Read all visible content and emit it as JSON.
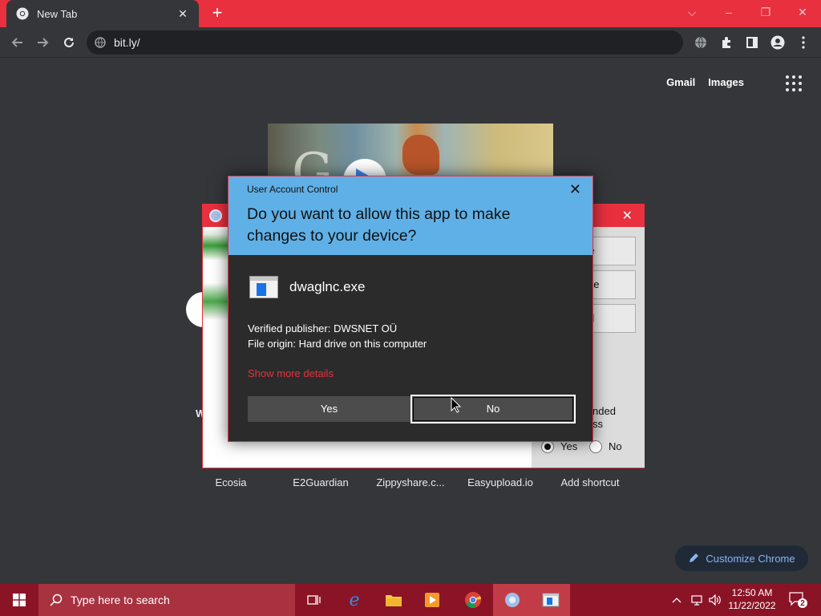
{
  "browser": {
    "tab": {
      "title": "New Tab"
    },
    "address": {
      "url": "bit.ly/"
    },
    "new_tab_label": "+",
    "window_controls": {
      "minimize": "–",
      "restore": "❐",
      "close": "✕",
      "tabsearch": "⌵"
    }
  },
  "newtab_page": {
    "top_links": [
      "Gmail",
      "Images"
    ],
    "shortcuts": [
      {
        "label": "Ecosia"
      },
      {
        "label": "E2Guardian"
      },
      {
        "label": "Zippyshare.c..."
      },
      {
        "label": "Easyupload.io"
      },
      {
        "label": "Add shortcut"
      }
    ],
    "customize_label": "Customize Chrome",
    "doodle_text": "G"
  },
  "installer": {
    "buttons": [
      "ble",
      "igure",
      "tall"
    ],
    "option_text": [
      "nded",
      "ss"
    ],
    "radio_yes": "Yes",
    "radio_no": "No",
    "left_fragment": "W"
  },
  "uac": {
    "title": "User Account Control",
    "question": "Do you want to allow this app to make changes to your device?",
    "app_name": "dwaglnc.exe",
    "publisher": "Verified publisher: DWSNET OÜ",
    "origin": "File origin: Hard drive on this computer",
    "more_details": "Show more details",
    "yes_label": "Yes",
    "no_label": "No"
  },
  "taskbar": {
    "search_placeholder": "Type here to search",
    "time": "12:50 AM",
    "date": "11/22/2022",
    "notification_count": "2"
  },
  "colors": {
    "accent_red": "#e8303f",
    "uac_header": "#5fb0e6",
    "taskbar": "#8a1426",
    "chrome_dark": "#35363a"
  }
}
